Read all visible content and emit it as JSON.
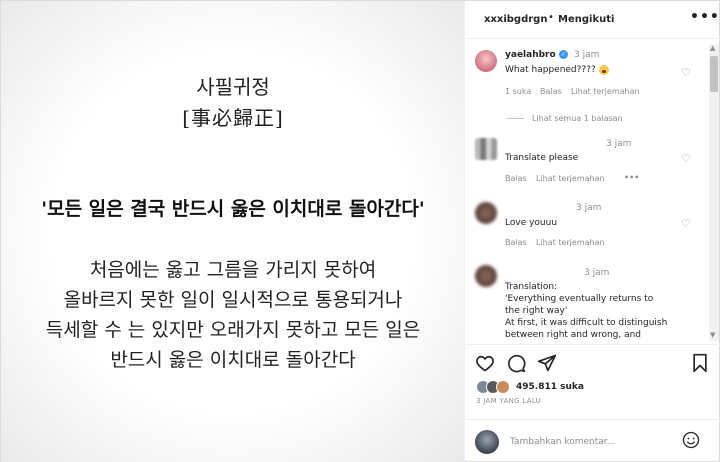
{
  "post_image": {
    "title_korean": "사필귀정",
    "title_hanja": "[事必歸正]",
    "quote": "'모든 일은 결국 반드시 옳은 이치대로 돌아간다'",
    "body_lines": [
      "처음에는 옳고 그름을 가리지 못하여",
      "올바르지 못한 일이 일시적으로 통용되거나",
      "득세할 수 는 있지만 오래가지 못하고 모든 일은",
      "반드시 옳은 이치대로 돌아간다"
    ]
  },
  "header": {
    "username": "xxxibgdrgn",
    "separator": "•",
    "follow_status": "Mengikuti",
    "more_label": "•••"
  },
  "comments": [
    {
      "username": "yaelahbro",
      "verified": true,
      "time": "3 jam",
      "text": "What happened????",
      "likes": "1 suka",
      "reply": "Balas",
      "translate": "Lihat terjemahan",
      "view_replies": "Lihat semua 1 balasan"
    },
    {
      "username": "",
      "time": "3 jam",
      "text": "Translate please",
      "reply": "Balas",
      "translate": "Lihat terjemahan",
      "more": "•••"
    },
    {
      "username": "",
      "time": "3 jam",
      "text": "Love youuu",
      "reply": "Balas",
      "translate": "Lihat terjemahan"
    },
    {
      "username": "",
      "time": "3 jam",
      "text_lines": [
        "Translation:",
        "'Everything eventually returns to",
        "the right way'",
        "At first, it was difficult to distinguish",
        "between right and wrong, and"
      ]
    }
  ],
  "actions": {
    "like_count": "495.811 suka",
    "posted_ago": "3 JAM YANG LALU"
  },
  "composer": {
    "placeholder": "Tambahkan komentar..."
  },
  "colors": {
    "text": "#262626",
    "muted": "#8e8e8e",
    "verified": "#3897f0",
    "border": "#dbdbdb"
  },
  "icons": {
    "like": "heart-icon",
    "comment": "comment-icon",
    "share": "paper-plane-icon",
    "save": "bookmark-icon",
    "emoji": "smiley-icon",
    "more": "more-icon"
  }
}
